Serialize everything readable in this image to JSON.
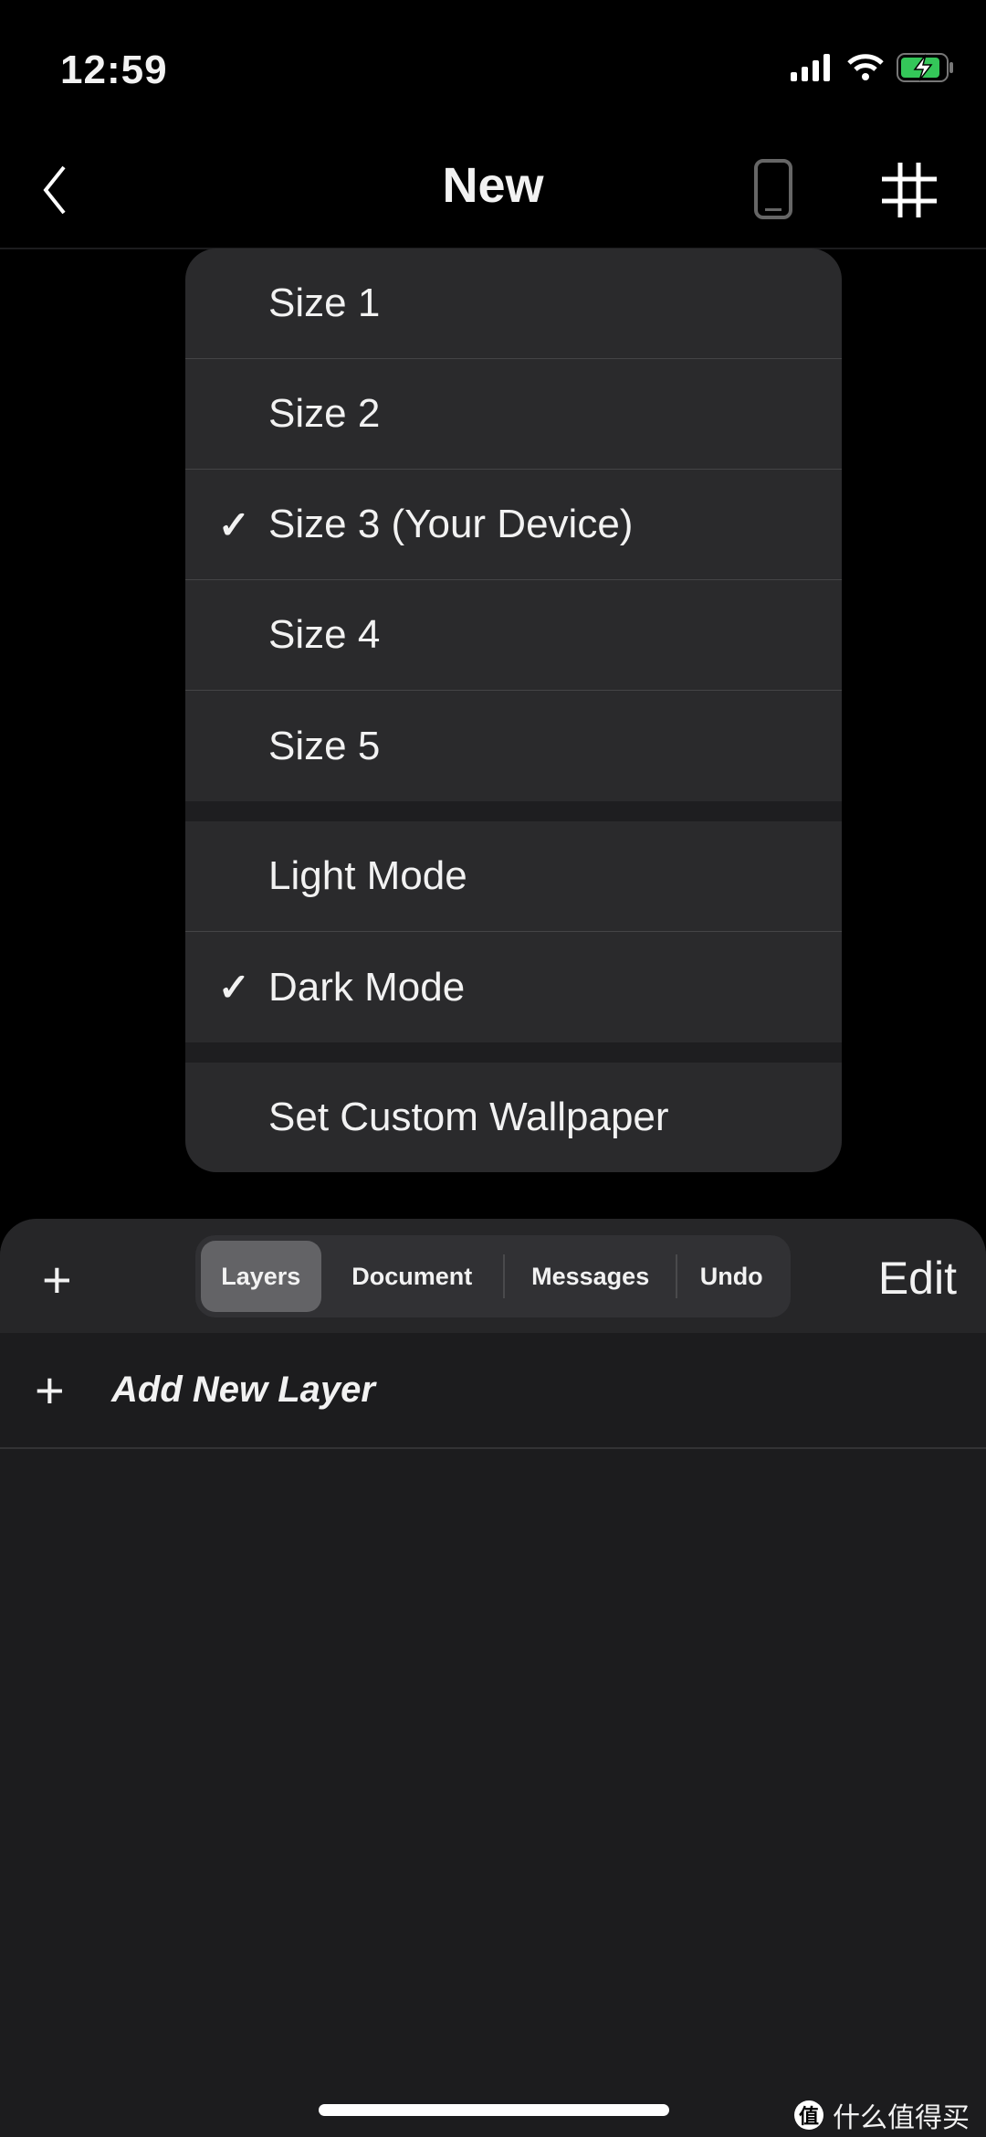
{
  "status_bar": {
    "time": "12:59",
    "battery_color": "#34c759"
  },
  "nav": {
    "title": "New",
    "back_icon": "chevron-left-icon",
    "device_icon": "iphone-icon",
    "grid_icon": "grid-icon"
  },
  "menu": {
    "sizes": [
      {
        "label": "Size 1",
        "checked": false
      },
      {
        "label": "Size 2",
        "checked": false
      },
      {
        "label": "Size 3 (Your Device)",
        "checked": true
      },
      {
        "label": "Size 4",
        "checked": false
      },
      {
        "label": "Size 5",
        "checked": false
      }
    ],
    "modes": [
      {
        "label": "Light Mode",
        "checked": false
      },
      {
        "label": "Dark Mode",
        "checked": true
      }
    ],
    "wallpaper": "Set Custom Wallpaper",
    "check_mark": "✓"
  },
  "toolbar": {
    "plus": "+",
    "tabs": [
      "Layers",
      "Document",
      "Messages",
      "Undo"
    ],
    "active_tab": "Layers",
    "edit": "Edit"
  },
  "layers": {
    "add_plus": "+",
    "add_label": "Add New Layer"
  },
  "watermark": {
    "logo": "值",
    "text": "什么值得买"
  }
}
